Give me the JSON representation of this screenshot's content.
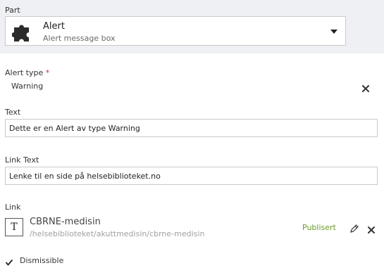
{
  "part": {
    "label": "Part",
    "selected_title": "Alert",
    "selected_subtitle": "Alert message box",
    "icon": "puzzle-icon"
  },
  "alert_type": {
    "label": "Alert type",
    "required_mark": "*",
    "value": "Warning"
  },
  "text_field": {
    "label": "Text",
    "value": "Dette er en Alert av type Warning"
  },
  "link_text_field": {
    "label": "Link Text",
    "value": "Lenke til en side på helsebiblioteket.no"
  },
  "link": {
    "label": "Link",
    "type_icon_letter": "T",
    "title": "CBRNE-medisin",
    "path": "/helsebiblioteket/akuttmedisin/cbrne-medisin",
    "status": "Publisert",
    "status_color": "#6a9a2a"
  },
  "dismissible": {
    "label": "Dismissible",
    "checked": true
  }
}
